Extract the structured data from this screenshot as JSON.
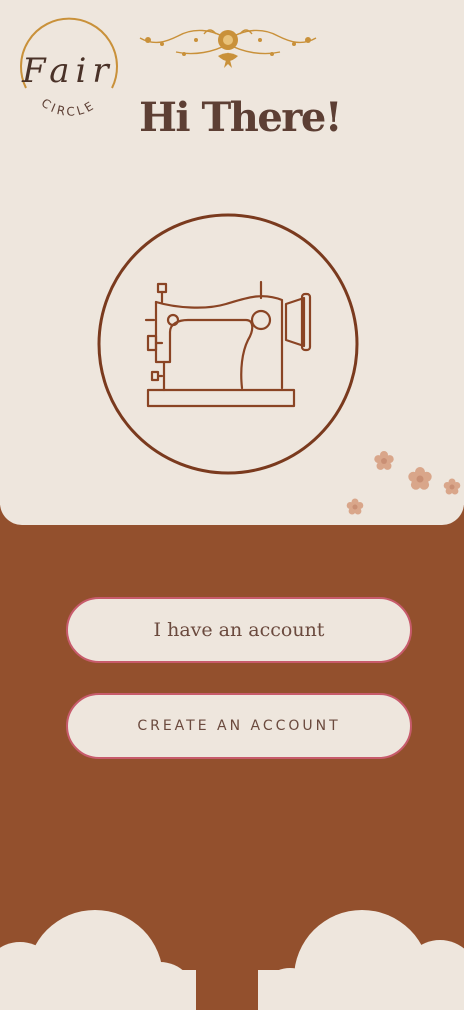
{
  "logo": {
    "script_text": "Fair",
    "ring_text": "CIRCLE"
  },
  "greeting": {
    "title": "Hi There!"
  },
  "hero": {
    "icon": "sewing-machine-icon"
  },
  "actions": {
    "login_label": "I have an account",
    "create_label": "CREATE AN ACCOUNT"
  },
  "colors": {
    "background": "#eee6dd",
    "accent_brown": "#93502d",
    "text_dark": "#5d3f34",
    "button_border": "#c75b6b",
    "gold": "#c9913a",
    "flower": "#d9a68a"
  }
}
